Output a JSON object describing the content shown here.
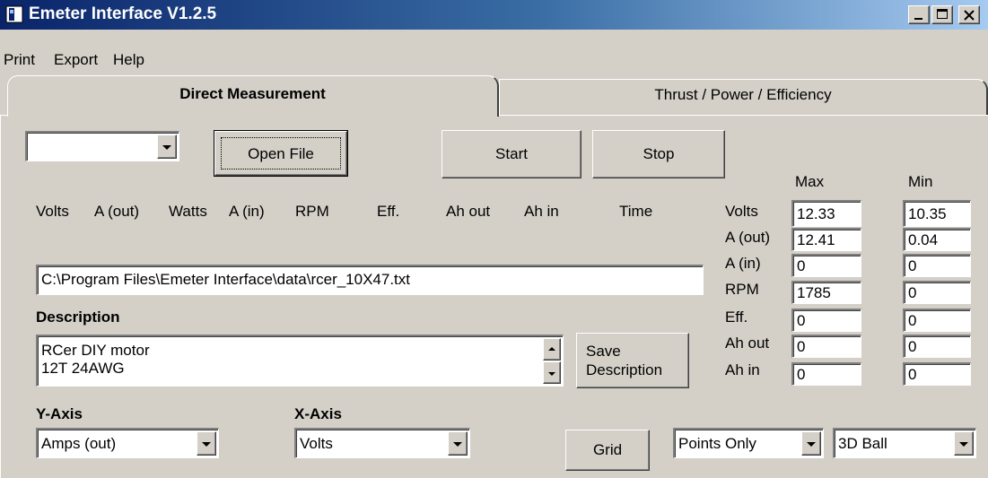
{
  "window": {
    "title": "Emeter Interface V1.2.5"
  },
  "menu": [
    "Print",
    "Export",
    "Help"
  ],
  "tabs": [
    {
      "label": "Direct Measurement",
      "active": true
    },
    {
      "label": "Thrust / Power / Efficiency",
      "active": false
    }
  ],
  "controls": {
    "port_select": "",
    "open_file": "Open File",
    "start": "Start",
    "stop": "Stop",
    "save_description": [
      "Save",
      "Description"
    ],
    "grid": "Grid"
  },
  "columns": [
    "Volts",
    "A (out)",
    "Watts",
    "A (in)",
    "RPM",
    "Eff.",
    "Ah out",
    "Ah in",
    "Time"
  ],
  "file_path": "C:\\Program Files\\Emeter Interface\\data\\rcer_10X47.txt",
  "description": {
    "label": "Description",
    "lines": [
      "RCer DIY motor",
      "12T 24AWG"
    ]
  },
  "stats": {
    "max_label": "Max",
    "min_label": "Min",
    "rows": [
      {
        "label": "Volts",
        "max": "12.33",
        "min": "10.35"
      },
      {
        "label": "A (out)",
        "max": "12.41",
        "min": "0.04"
      },
      {
        "label": "A (in)",
        "max": "0",
        "min": "0"
      },
      {
        "label": "RPM",
        "max": "1785",
        "min": "0"
      },
      {
        "label": "Eff.",
        "max": "0",
        "min": "0"
      },
      {
        "label": "Ah out",
        "max": "0",
        "min": "0"
      },
      {
        "label": "Ah in",
        "max": "0",
        "min": "0"
      }
    ]
  },
  "axes": {
    "y_label": "Y-Axis",
    "y_value": "Amps (out)",
    "x_label": "X-Axis",
    "x_value": "Volts"
  },
  "plot_options": {
    "style": "Points Only",
    "marker": "3D Ball"
  },
  "colors": {
    "title_bar": "#0a246a",
    "face": "#d4d0c8"
  }
}
